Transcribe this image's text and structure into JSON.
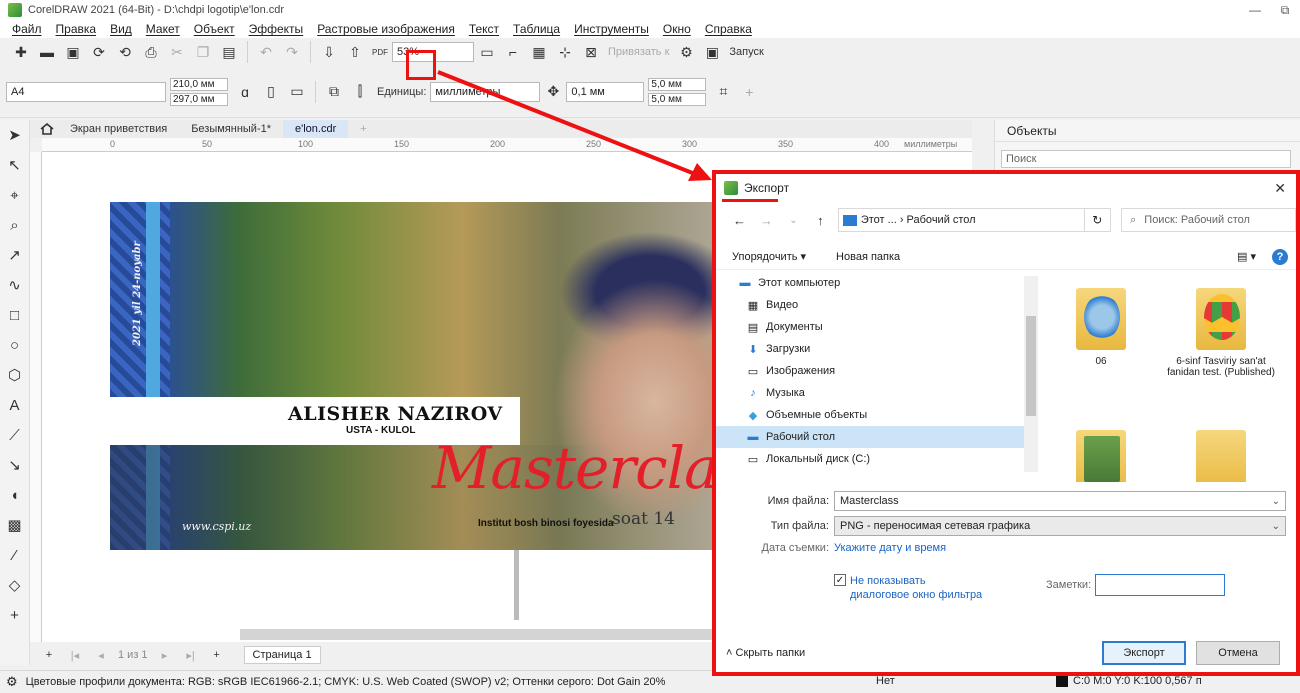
{
  "window": {
    "title": "CorelDRAW 2021 (64-Bit) - D:\\chdpi logotip\\e'lon.cdr",
    "controls": [
      "―",
      "⧉"
    ]
  },
  "menu": [
    "Файл",
    "Правка",
    "Вид",
    "Макет",
    "Объект",
    "Эффекты",
    "Растровые изображения",
    "Текст",
    "Таблица",
    "Инструменты",
    "Окно",
    "Справка"
  ],
  "toolbar": {
    "pdf_label": "PDF",
    "zoom": "53%",
    "snap_to": "Привязать к",
    "launch": "Запуск"
  },
  "propbar": {
    "page_size": "A4",
    "width": "210,0 мм",
    "height": "297,0 мм",
    "units_label": "Единицы:",
    "units": "миллиметры",
    "nudge": "0,1 мм",
    "dup_x": "5,0 мм",
    "dup_y": "5,0 мм"
  },
  "doc_tabs": [
    "Экран приветствия",
    "Безымянный-1*",
    "e'lon.cdr"
  ],
  "ruler": {
    "ticks": [
      "0",
      "50",
      "100",
      "150",
      "200",
      "250",
      "300",
      "350",
      "400"
    ],
    "unit": "миллиметры"
  },
  "design": {
    "date_vertical": "2021 yil 24-noyabr",
    "name": "ALISHER NAZIROV",
    "subtitle": "USTA - KULOL",
    "title": "Masterclass",
    "location": "Institut bosh binosi foyesida",
    "time": "soat 14",
    "website": "www.cspi.uz"
  },
  "page_nav": {
    "position": "1 из 1",
    "page_tab": "Страница 1"
  },
  "status": {
    "color_profiles": "Цветовые профили документа: RGB: sRGB IEC61966-2.1; CMYK: U.S. Web Coated (SWOP) v2; Оттенки серого: Dot Gain 20%",
    "fill": "Нет",
    "outline": "C:0 M:0 Y:0 K:100  0,567 п"
  },
  "docker": {
    "title": "Объекты",
    "search_placeholder": "Поиск"
  },
  "dialog": {
    "title": "Экспорт",
    "breadcrumb": "Этот ... › Рабочий стол",
    "search_placeholder": "Поиск: Рабочий стол",
    "organize": "Упорядочить ▾",
    "new_folder": "Новая папка",
    "tree": [
      {
        "label": "Этот компьютер",
        "icon": "computer-icon"
      },
      {
        "label": "Видео",
        "icon": "video-icon"
      },
      {
        "label": "Документы",
        "icon": "documents-icon"
      },
      {
        "label": "Загрузки",
        "icon": "download-icon"
      },
      {
        "label": "Изображения",
        "icon": "images-icon"
      },
      {
        "label": "Музыка",
        "icon": "music-icon"
      },
      {
        "label": "Объемные объекты",
        "icon": "3d-objects-icon"
      },
      {
        "label": "Рабочий стол",
        "icon": "desktop-icon"
      },
      {
        "label": "Локальный диск (C:)",
        "icon": "drive-icon"
      }
    ],
    "files": [
      {
        "label": "06"
      },
      {
        "label": "6-sinf Tasviriy san'at fanidan test. (Published)"
      },
      {
        "label": ""
      },
      {
        "label": ""
      }
    ],
    "filename_label": "Имя файла:",
    "filename": "Masterclass",
    "filetype_label": "Тип файла:",
    "filetype": "PNG - переносимая сетевая графика",
    "date_label": "Дата съемки:",
    "date_link": "Укажите дату и время",
    "no_filter_line1": "Не показывать",
    "no_filter_line2": "диалоговое окно фильтра",
    "notes_label": "Заметки:",
    "hide_folders": "Скрыть папки",
    "export_btn": "Экспорт",
    "cancel_btn": "Отмена"
  },
  "colors": {
    "annotation": "#e11111",
    "accent": "#2b7bd1",
    "masterclass_red": "#e3202a"
  }
}
